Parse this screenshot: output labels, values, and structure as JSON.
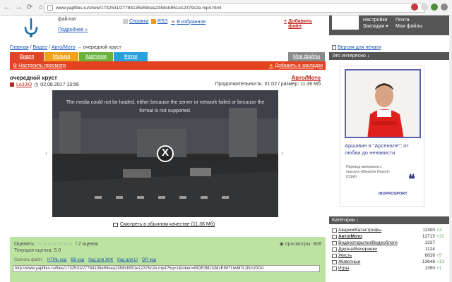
{
  "browser": {
    "url": "www.yapfiles.ru/show/1732531/27784135e59cea2358cb951e12379c2e.mp4.html",
    "ext_colors": [
      "#c43a3a",
      "#d9d9d9",
      "#4b8f3a",
      "#888888"
    ]
  },
  "header": {
    "files_text": "файлов",
    "more_link": "Подробнее »",
    "help_link": "Справка",
    "rss_link": "RSS",
    "favorites_link": "В избранное",
    "add_file_link": "Добавить файл"
  },
  "right_top": {
    "settings": "Настройки",
    "bookmarks": "Закладки ▾",
    "mail": "Почта",
    "my_files": "Мои файлы"
  },
  "breadcrumb": {
    "home": "Главная",
    "video": "Видео",
    "auto": "Авто/Мото",
    "sep": "/",
    "arrow": "→",
    "current": "очередной хруст"
  },
  "print_version": "Версия для печати",
  "tabs": [
    "Видео",
    "Музыка",
    "Картинки",
    "Фотки"
  ],
  "my_files_tab": "Мои файлы",
  "orange_bar": {
    "settings": "Настроить просмотр",
    "add_bookmark": "Добавить в закладки"
  },
  "video": {
    "title": "очередной хруст",
    "category": "Авто/Мото",
    "user": "Lo3JiO",
    "date": "02.08.2017 13:56",
    "meta": "Продолжительность: 01:02 / размер: 11.36 Мб",
    "error_text": "The media could not be loaded, either because the server or network failed or because the format is not supported.",
    "close": "X",
    "prev_arrow": "‹",
    "next_arrow": "›"
  },
  "quality_link": "Смотреть в обычном качестве (11.36 Мб)",
  "rating": {
    "label": "Оценить:",
    "stars": "☆☆☆☆☆☆☆",
    "count": "/ 2 оценок",
    "current": "Текущая оценка: 5.0",
    "views": "просмотры: 808",
    "dl_label": "Скачать файл:",
    "dl_links": [
      "HTML код",
      "BB код",
      "Код для ЖЖ",
      "Код для LI",
      "QR код"
    ],
    "link_value": "http://www.yapfiles.ru/files/1732531/27784135e59cea2358cb951e12379c2e.mp4?hq=1&token=MDE3MzI1MzEtMTUwMTc1NzU0OA"
  },
  "interesting_header": "Это интересно ↓",
  "ad": {
    "title": "Аршавин в \"Арсенале\": от любви до ненависти",
    "source": "Перевод материала с портала «Bleacher Report» (США)",
    "quote": "❝",
    "brand": "INOPROSPORT"
  },
  "categories_header": "Категории ↓",
  "categories": [
    {
      "name": "Аварии/Катастрофы",
      "count": "11300",
      "delta": "+3"
    },
    {
      "name": "Авто/Мото",
      "count": "12715",
      "delta": "+22"
    },
    {
      "name": "Видеооткрытки/Видеоблоги",
      "count": "1337",
      "delta": ""
    },
    {
      "name": "Друзья/Вечеринки",
      "count": "1124",
      "delta": ""
    },
    {
      "name": "Жесть",
      "count": "6826",
      "delta": "+5"
    },
    {
      "name": "Животные",
      "count": "13648",
      "delta": "+13"
    },
    {
      "name": "Игры",
      "count": "1350",
      "delta": "+1"
    }
  ]
}
